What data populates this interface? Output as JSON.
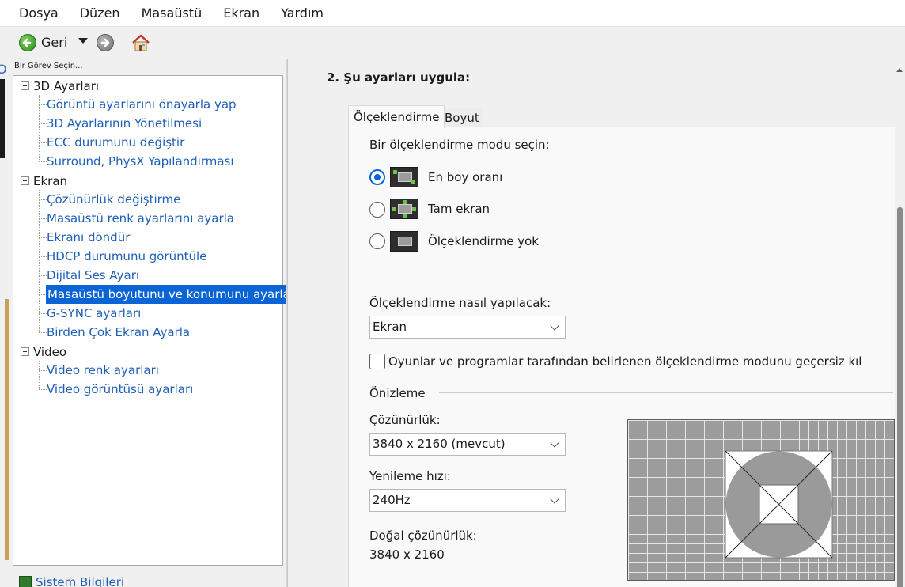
{
  "menu": {
    "items": [
      "Dosya",
      "Düzen",
      "Masaüstü",
      "Ekran",
      "Yardım"
    ]
  },
  "toolbar": {
    "back_label": "Geri"
  },
  "sidebar": {
    "task_label": "Bir Görev Seçin...",
    "groups": [
      {
        "label": "3D Ayarları",
        "items": [
          "Görüntü ayarlarını önayarla yap",
          "3D Ayarlarının Yönetilmesi",
          "ECC durumunu değiştir",
          "Surround, PhysX Yapılandırması"
        ]
      },
      {
        "label": "Ekran",
        "items": [
          "Çözünürlük değiştirme",
          "Masaüstü renk ayarlarını ayarla",
          "Ekranı döndür",
          "HDCP durumunu görüntüle",
          "Dijital Ses Ayarı",
          "Masaüstü boyutunu ve konumunu ayarla",
          "G-SYNC ayarları",
          "Birden Çok Ekran Ayarla"
        ]
      },
      {
        "label": "Video",
        "items": [
          "Video renk ayarları",
          "Video görüntüsü ayarları"
        ]
      }
    ],
    "selected_item": "Masaüstü boyutunu ve konumunu ayarla",
    "system_info": "Sistem Bilgileri"
  },
  "main": {
    "section_title": "2. Şu ayarları uygula:",
    "tabs": [
      "Ölçeklendirme",
      "Boyut"
    ],
    "active_tab": "Ölçeklendirme",
    "mode_prompt": "Bir ölçeklendirme modu seçin:",
    "modes": [
      {
        "label": "En boy oranı",
        "checked": true
      },
      {
        "label": "Tam ekran",
        "checked": false
      },
      {
        "label": "Ölçeklendirme yok",
        "checked": false
      }
    ],
    "perform_label": "Ölçeklendirme nasıl yapılacak:",
    "perform_value": "Ekran",
    "override_label": "Oyunlar ve programlar tarafından belirlenen ölçeklendirme modunu geçersiz kıl",
    "override_checked": false,
    "preview_label": "Önizleme",
    "resolution_label": "Çözünürlük:",
    "resolution_value": "3840 x 2160 (mevcut)",
    "refresh_label": "Yenileme hızı:",
    "refresh_value": "240Hz",
    "native_label": "Doğal çözünürlük:",
    "native_value": "3840 x 2160"
  },
  "colors": {
    "accent": "#0a64d6",
    "link": "#1e5fb8",
    "green_icon": "#2e8b1e"
  },
  "icons": {
    "back": "green-left-arrow-circle-icon",
    "forward": "gray-right-arrow-circle-icon",
    "home": "house-icon",
    "system_info": "nvidia-logo-icon"
  }
}
